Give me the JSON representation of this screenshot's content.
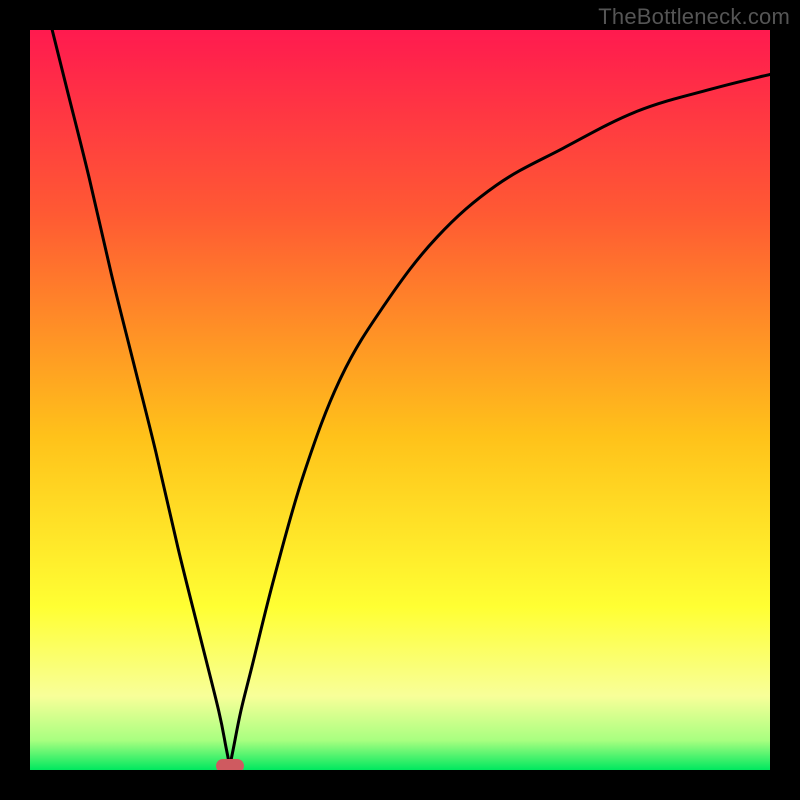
{
  "watermark": "TheBottleneck.com",
  "marker": {
    "color": "#cf5a60"
  },
  "chart_data": {
    "type": "line",
    "title": "",
    "xlabel": "",
    "ylabel": "",
    "xlim": [
      0,
      100
    ],
    "ylim": [
      0,
      100
    ],
    "gradient_stops": [
      {
        "pct": 0,
        "color": "#ff1a4f"
      },
      {
        "pct": 25,
        "color": "#ff5a33"
      },
      {
        "pct": 55,
        "color": "#ffc21a"
      },
      {
        "pct": 78,
        "color": "#ffff33"
      },
      {
        "pct": 90,
        "color": "#f8ff99"
      },
      {
        "pct": 96,
        "color": "#a8ff80"
      },
      {
        "pct": 100,
        "color": "#00e85f"
      }
    ],
    "vertex_x": 27,
    "marker": {
      "x": 27,
      "y": 0.5
    },
    "series": [
      {
        "name": "left-branch",
        "x": [
          3,
          5,
          8,
          11,
          14,
          17,
          20,
          23,
          25.5,
          26.5,
          27.0
        ],
        "values": [
          100,
          92,
          80,
          67,
          55,
          43,
          30,
          18,
          8,
          3,
          0.5
        ]
      },
      {
        "name": "right-branch",
        "x": [
          27.0,
          27.5,
          28.5,
          30,
          33,
          37,
          42,
          48,
          55,
          63,
          72,
          82,
          92,
          100
        ],
        "values": [
          0.5,
          3,
          8,
          14,
          26,
          40,
          53,
          63,
          72,
          79,
          84,
          89,
          92,
          94
        ]
      }
    ]
  }
}
